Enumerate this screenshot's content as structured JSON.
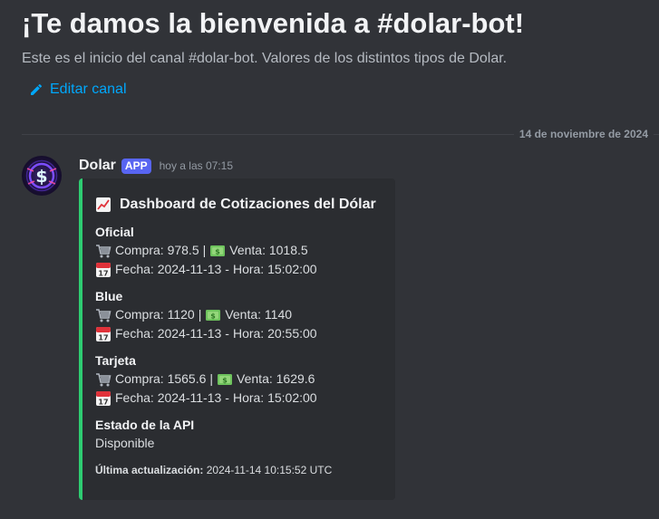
{
  "welcome": {
    "title": "¡Te damos la bienvenida a #dolar-bot!",
    "subtitle": "Este es el inicio del canal #dolar-bot. Valores de los distintos tipos de Dolar.",
    "edit_label": "Editar canal"
  },
  "divider_date": "14 de noviembre de 2024",
  "message": {
    "author": "Dolar",
    "badge": "APP",
    "timestamp": "hoy a las 07:15",
    "embed": {
      "accent": "#2ecc71",
      "title": "Dashboard de Cotizaciones del Dólar",
      "sections": [
        {
          "name": "Oficial",
          "compra_label": "Compra:",
          "compra": "978.5",
          "venta_label": "Venta:",
          "venta": "1018.5",
          "fecha_label": "Fecha:",
          "fecha": "2024-11-13",
          "hora_label": "Hora:",
          "hora": "15:02:00"
        },
        {
          "name": "Blue",
          "compra_label": "Compra:",
          "compra": "1120",
          "venta_label": "Venta:",
          "venta": "1140",
          "fecha_label": "Fecha:",
          "fecha": "2024-11-13",
          "hora_label": "Hora:",
          "hora": "20:55:00"
        },
        {
          "name": "Tarjeta",
          "compra_label": "Compra:",
          "compra": "1565.6",
          "venta_label": "Venta:",
          "venta": "1629.6",
          "fecha_label": "Fecha:",
          "fecha": "2024-11-13",
          "hora_label": "Hora:",
          "hora": "15:02:00"
        }
      ],
      "status_name": "Estado de la API",
      "status_value": "Disponible",
      "footer_label": "Última actualización:",
      "footer_value": "2024-11-14 10:15:52 UTC"
    }
  }
}
